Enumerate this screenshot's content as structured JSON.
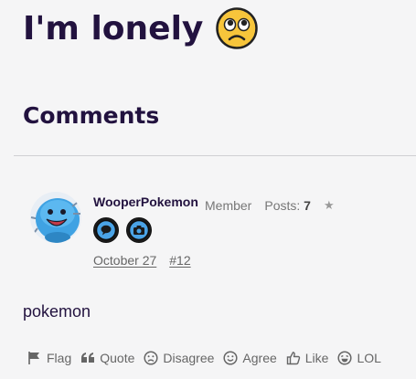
{
  "discussion": {
    "title": "I'm lonely",
    "title_emoji": "pleading-face-emoji"
  },
  "comments_heading": "Comments",
  "comment": {
    "username": "WooperPokemon",
    "role": "Member",
    "posts_label": "Posts:",
    "posts_count": "7",
    "badges": [
      "first-comment-badge-icon",
      "photogenic-badge-icon"
    ],
    "date": "October 27",
    "permalink": "#12",
    "body": "pokemon"
  },
  "reactions": [
    {
      "label": "Flag",
      "icon": "flag-icon"
    },
    {
      "label": "Quote",
      "icon": "quote-icon"
    },
    {
      "label": "Disagree",
      "icon": "frown-icon"
    },
    {
      "label": "Agree",
      "icon": "smile-icon"
    },
    {
      "label": "Like",
      "icon": "thumbs-up-icon"
    },
    {
      "label": "LOL",
      "icon": "laugh-icon"
    }
  ],
  "colors": {
    "heading": "#22123f",
    "background": "#f5f5f6",
    "meta": "#666666",
    "badge_accent": "#4aa3e6"
  }
}
